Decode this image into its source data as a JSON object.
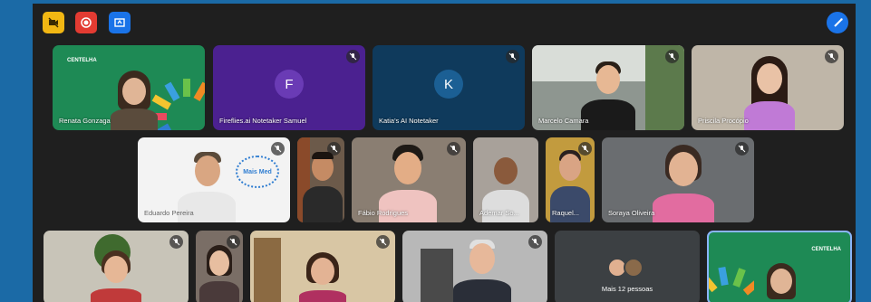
{
  "toolbar": {
    "icons": [
      "video-off-icon",
      "record-icon",
      "share-screen-icon",
      "edit-pen-icon"
    ],
    "colors": {
      "yellow": "#f2b713",
      "red": "#e33b32",
      "blue": "#1a73e8"
    }
  },
  "participants": [
    {
      "name": "Renata Gonzaga",
      "muted": false
    },
    {
      "name": "Fireflies.ai Notetaker Samuel",
      "avatar": "F",
      "muted": true
    },
    {
      "name": "Katia's AI Notetaker",
      "avatar": "K",
      "muted": true
    },
    {
      "name": "Marcelo Camara",
      "muted": true
    },
    {
      "name": "Priscila Procópio",
      "muted": true
    },
    {
      "name": "Eduardo Pereira",
      "muted": true
    },
    {
      "name": "",
      "muted": true
    },
    {
      "name": "Fábio Rodrigues",
      "muted": true
    },
    {
      "name": "Ademar So...",
      "muted": false
    },
    {
      "name": "Raquel...",
      "muted": true
    },
    {
      "name": "Soraya Oliveira",
      "muted": true
    },
    {
      "name": "",
      "muted": true
    },
    {
      "name": "",
      "muted": true
    },
    {
      "name": "",
      "muted": true
    },
    {
      "name": "",
      "muted": true
    }
  ],
  "logos": {
    "centelha": "CENTELHA",
    "mais_med": "Mais Med"
  },
  "overflow": {
    "label": "Mais 12 pessoas"
  }
}
